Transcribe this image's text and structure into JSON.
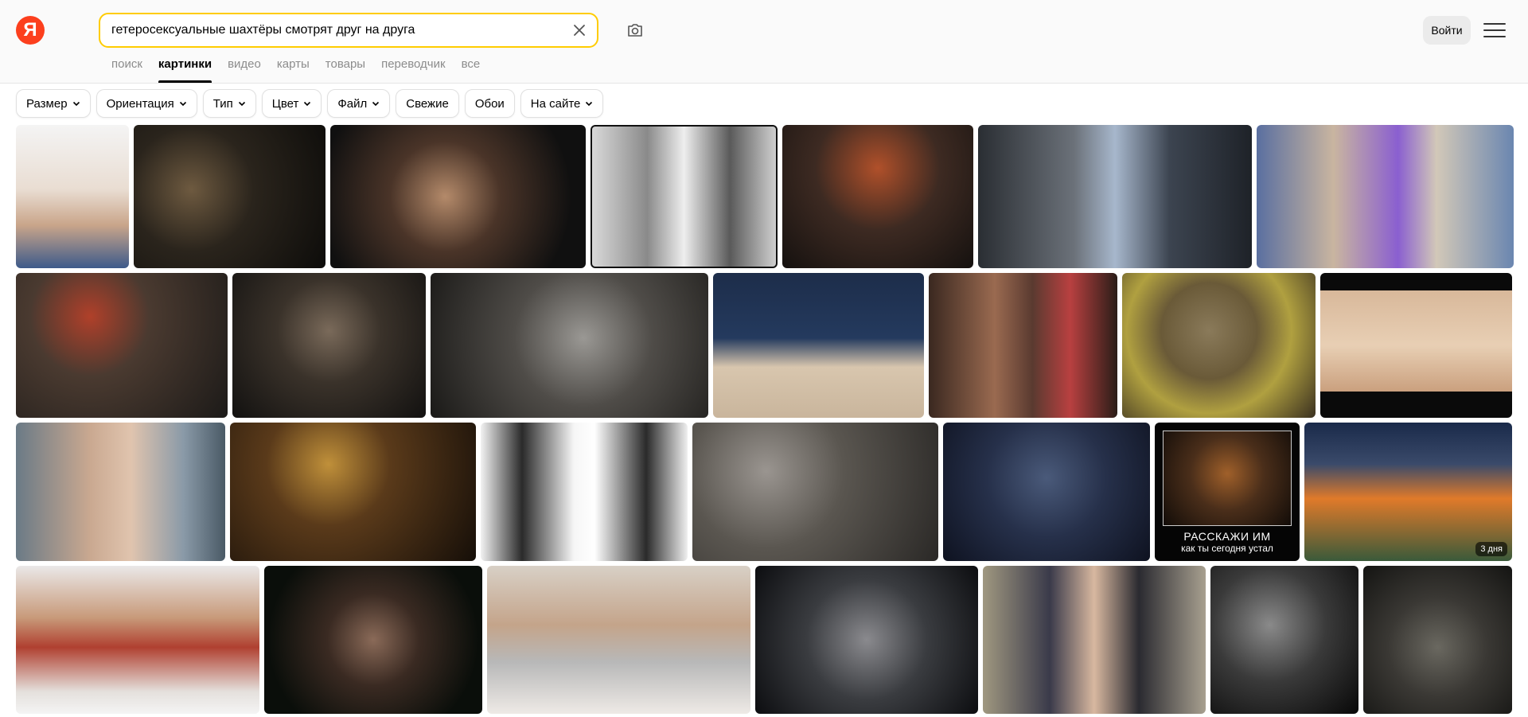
{
  "header": {
    "logo_text": "Я",
    "search_value": "гетеросексуальные шахтёры смотрят друг на друга",
    "login_label": "Войти",
    "accent_color": "#ffcc00",
    "brand_color": "#fc3f1d"
  },
  "tabs": [
    {
      "label": "поиск"
    },
    {
      "label": "картинки"
    },
    {
      "label": "видео"
    },
    {
      "label": "карты"
    },
    {
      "label": "товары"
    },
    {
      "label": "переводчик"
    },
    {
      "label": "все"
    }
  ],
  "filters": [
    {
      "label": "Размер",
      "dropdown": true
    },
    {
      "label": "Ориентация",
      "dropdown": true
    },
    {
      "label": "Тип",
      "dropdown": true
    },
    {
      "label": "Цвет",
      "dropdown": true
    },
    {
      "label": "Файл",
      "dropdown": true
    },
    {
      "label": "Свежие",
      "dropdown": false
    },
    {
      "label": "Обои",
      "dropdown": false
    },
    {
      "label": "На сайте",
      "dropdown": true
    }
  ],
  "image_badge": "3 дня",
  "demotivator": {
    "title": "РАССКАЖИ ИМ",
    "subtitle": "как ты сегодня устал"
  }
}
